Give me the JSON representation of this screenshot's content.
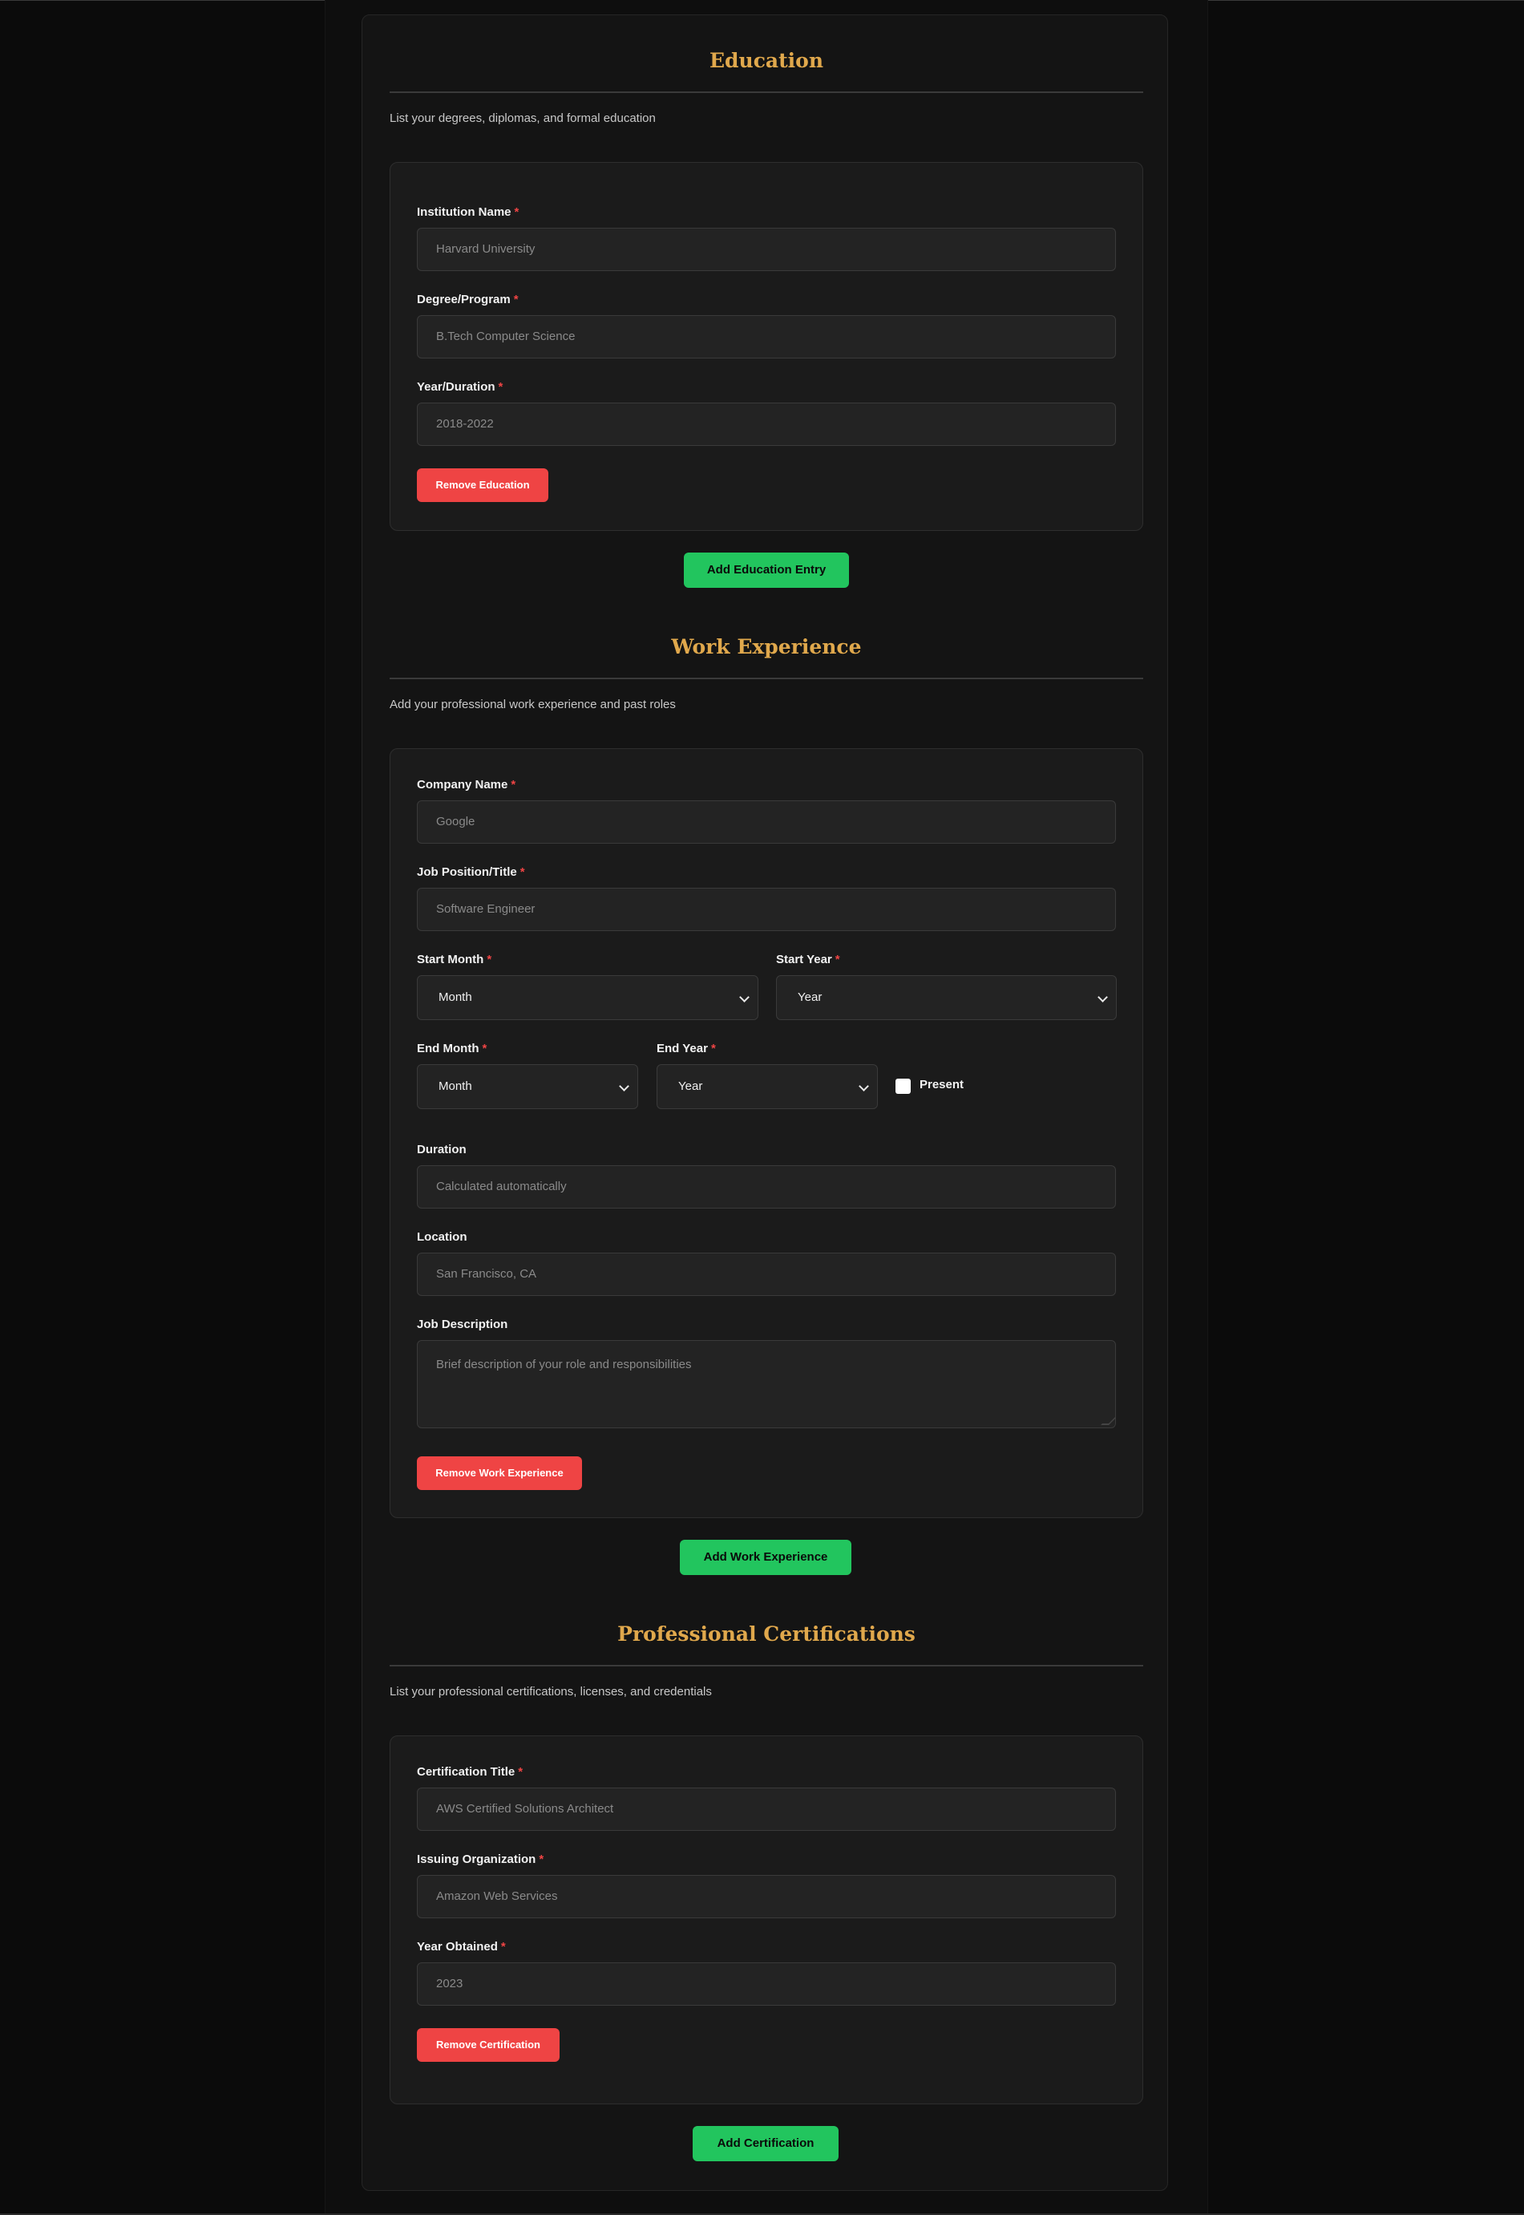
{
  "colors": {
    "background": "#0b0b0b",
    "card": "#141414",
    "entry_card": "#1b1b1b",
    "heading_gold": "#e0a84c",
    "danger_red": "#ef4444",
    "success_green": "#22c55e",
    "required_mark": "#ef4444"
  },
  "required_marker": "*",
  "education": {
    "title": "Education",
    "description": "List your degrees, diplomas, and formal education",
    "institution_label": "Institution Name",
    "institution_placeholder": "Harvard University",
    "degree_label": "Degree/Program",
    "degree_placeholder": "B.Tech Computer Science",
    "year_label": "Year/Duration",
    "year_placeholder": "2018-2022",
    "remove_label": "Remove Education",
    "add_label": "Add Education Entry"
  },
  "work": {
    "title": "Work Experience",
    "description": "Add your professional work experience and past roles",
    "company_label": "Company Name",
    "company_placeholder": "Google",
    "position_label": "Job Position/Title",
    "position_placeholder": "Software Engineer",
    "start_month_label": "Start Month",
    "start_month_value": "Month",
    "start_year_label": "Start Year",
    "start_year_value": "Year",
    "end_month_label": "End Month",
    "end_month_value": "Month",
    "end_year_label": "End Year",
    "end_year_value": "Year",
    "present_label": "Present",
    "present_checked": false,
    "duration_label": "Duration",
    "duration_placeholder": "Calculated automatically",
    "location_label": "Location",
    "location_placeholder": "San Francisco, CA",
    "description_label": "Job Description",
    "description_placeholder": "Brief description of your role and responsibilities",
    "remove_label": "Remove Work Experience",
    "add_label": "Add Work Experience"
  },
  "certifications": {
    "title": "Professional Certifications",
    "description": "List your professional certifications, licenses, and credentials",
    "cert_title_label": "Certification Title",
    "cert_title_placeholder": "AWS Certified Solutions Architect",
    "org_label": "Issuing Organization",
    "org_placeholder": "Amazon Web Services",
    "year_label": "Year Obtained",
    "year_placeholder": "2023",
    "remove_label": "Remove Certification",
    "add_label": "Add Certification"
  }
}
